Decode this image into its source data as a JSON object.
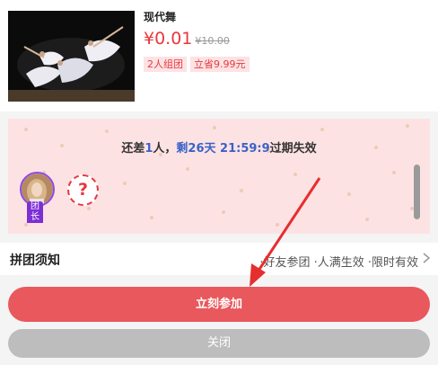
{
  "product": {
    "title": "现代舞",
    "price": "¥0.01",
    "original_price": "¥10.00",
    "tags": [
      "2人组团",
      "立省9.99元"
    ]
  },
  "group": {
    "status_prefix": "还差",
    "people_needed": "1",
    "people_unit": "人，",
    "remain_label": "剩26天",
    "countdown": "21:59:9",
    "status_suffix": "过期失效",
    "leader_badge": "团长",
    "empty_slot_symbol": "?"
  },
  "notice": {
    "title": "拼团须知",
    "text": "·好友参团 ·人满生效 ·限时有效"
  },
  "buttons": {
    "join": "立刻参加",
    "close": "关闭"
  },
  "colors": {
    "accent": "#e8383d",
    "join_button": "#e8585d",
    "close_button": "#bdbdbd",
    "highlight": "#3a62c7",
    "leader": "#7c2fd5"
  }
}
